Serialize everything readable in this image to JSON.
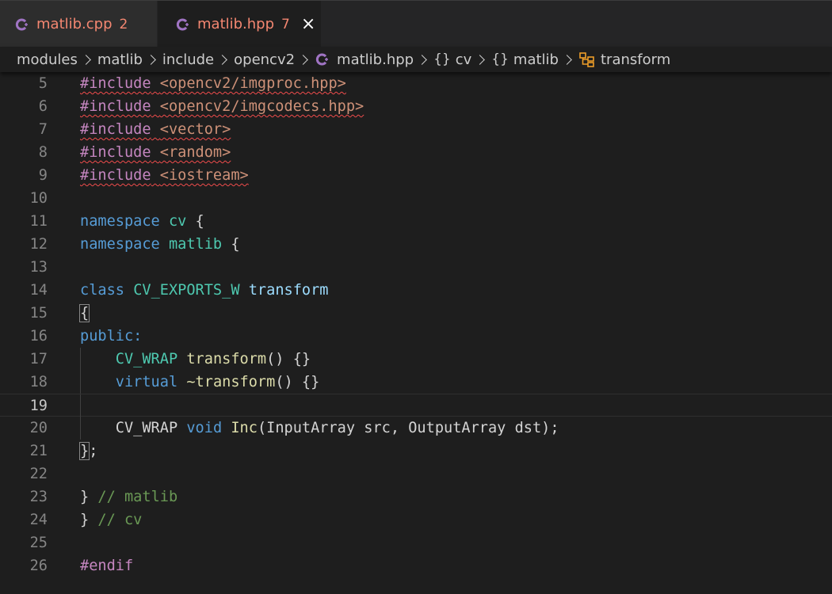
{
  "tabs": [
    {
      "name": "matlib.cpp",
      "count": "2"
    },
    {
      "name": "matlib.hpp",
      "count": "7",
      "close": "×"
    }
  ],
  "breadcrumb": {
    "c1": "modules",
    "c2": "matlib",
    "c3": "include",
    "c4": "opencv2",
    "c5": "matlib.hpp",
    "c6_brace": "{}",
    "c6": "cv",
    "c7_brace": "{}",
    "c7": "matlib",
    "c8": "transform"
  },
  "code": {
    "l5": {
      "n": "5",
      "a": "#include",
      "b": " ",
      "c": "<opencv2/imgproc.hpp>"
    },
    "l6": {
      "n": "6",
      "a": "#include",
      "b": " ",
      "c": "<opencv2/imgcodecs.hpp>"
    },
    "l7": {
      "n": "7",
      "a": "#include",
      "b": " ",
      "c": "<vector>"
    },
    "l8": {
      "n": "8",
      "a": "#include",
      "b": " ",
      "c": "<random>"
    },
    "l9": {
      "n": "9",
      "a": "#include",
      "b": " ",
      "c": "<iostream>"
    },
    "l10": {
      "n": "10"
    },
    "l11": {
      "n": "11",
      "a": "namespace",
      "b": " ",
      "c": "cv",
      "d": " {"
    },
    "l12": {
      "n": "12",
      "a": "namespace",
      "b": " ",
      "c": "matlib",
      "d": " {"
    },
    "l13": {
      "n": "13"
    },
    "l14": {
      "n": "14",
      "a": "class",
      "b": " ",
      "c": "CV_EXPORTS_W",
      "d": " ",
      "e": "transform"
    },
    "l15": {
      "n": "15",
      "a": "{"
    },
    "l16": {
      "n": "16",
      "a": "public:"
    },
    "l17": {
      "n": "17",
      "ind": "    ",
      "a": "CV_WRAP",
      "b": " ",
      "c": "transform",
      "d": "() {}"
    },
    "l18": {
      "n": "18",
      "ind": "    ",
      "a": "virtual",
      "b": " ",
      "c": "~transform",
      "d": "() {}"
    },
    "l19": {
      "n": "19"
    },
    "l20": {
      "n": "20",
      "ind": "    ",
      "a": "CV_WRAP",
      "b": " ",
      "c": "void",
      "d": " ",
      "e": "Inc",
      "f": "(InputArray src, OutputArray dst);"
    },
    "l21": {
      "n": "21",
      "a": "}",
      "b": ";"
    },
    "l22": {
      "n": "22"
    },
    "l23": {
      "n": "23",
      "a": "}",
      "b": " // matlib"
    },
    "l24": {
      "n": "24",
      "a": "}",
      "b": " // cv"
    },
    "l25": {
      "n": "25"
    },
    "l26": {
      "n": "26",
      "a": "#endif"
    }
  },
  "colors": {
    "tab_error": "#f48771",
    "cpp_icon": "#a074c4",
    "keyword": "#c586c0",
    "storage": "#569cd6",
    "string": "#ce9178",
    "type": "#4ec9b0",
    "function": "#dcdcaa",
    "comment": "#6a9955",
    "class_icon": "#ee9d28"
  },
  "icons": {
    "file": "cpp-file-icon",
    "class": "class-symbol-icon",
    "close": "close-icon"
  }
}
